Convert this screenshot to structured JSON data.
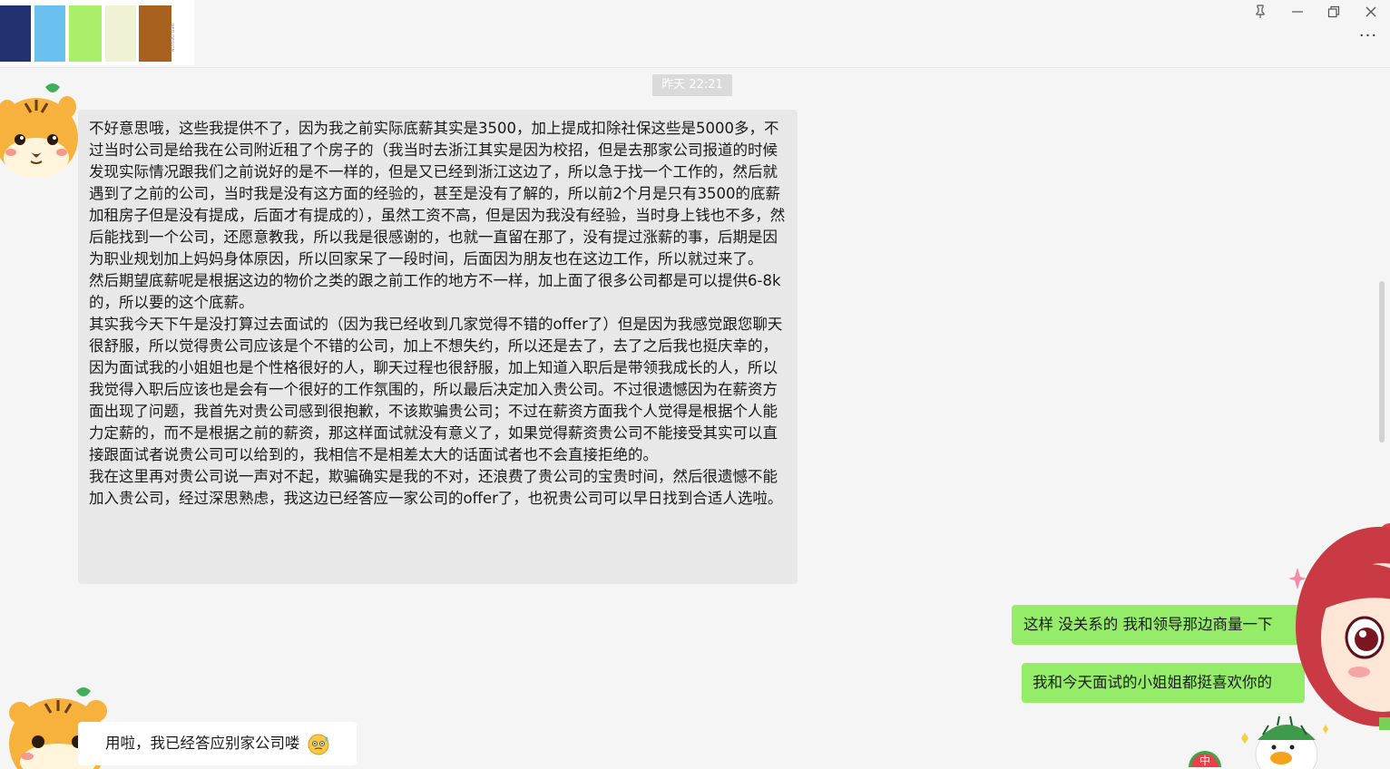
{
  "palette": {
    "swatches": [
      "#223170",
      "#6ac0ef",
      "#aaef6a",
      "#f1f1d6",
      "#a8601f"
    ],
    "caption": "RED DESIGN"
  },
  "window_controls": {
    "pin": "⊼",
    "minimize": "—",
    "restore": "❐",
    "close": "✕",
    "more": "···"
  },
  "chat": {
    "timestamp": "昨天 22:21",
    "messages": [
      {
        "side": "left",
        "text": "不好意思哦，这些我提供不了，因为我之前实际底薪其实是3500，加上提成扣除社保这些是5000多，不过当时公司是给我在公司附近租了个房子的（我当时去浙江其实是因为校招，但是去那家公司报道的时候发现实际情况跟我们之前说好的是不一样的，但是又已经到浙江这边了，所以急于找一个工作的，然后就遇到了之前的公司，当时我是没有这方面的经验的，甚至是没有了解的，所以前2个月是只有3500的底薪加租房子但是没有提成，后面才有提成的），虽然工资不高，但是因为我没有经验，当时身上钱也不多，然后能找到一个公司，还愿意教我，所以我是很感谢的，也就一直留在那了，没有提过涨薪的事，后期是因为职业规划加上妈妈身体原因，所以回家呆了一段时间，后面因为朋友也在这边工作，所以就过来了。\n然后期望底薪呢是根据这边的物价之类的跟之前工作的地方不一样，加上面了很多公司都是可以提供6-8k的，所以要的这个底薪。\n其实我今天下午是没打算过去面试的（因为我已经收到几家觉得不错的offer了）但是因为我感觉跟您聊天很舒服，所以觉得贵公司应该是个不错的公司，加上不想失约，所以还是去了，去了之后我也挺庆幸的，因为面试我的小姐姐也是个性格很好的人，聊天过程也很舒服，加上知道入职后是带领我成长的人，所以我觉得入职后应该也是会有一个很好的工作氛围的，所以最后决定加入贵公司。不过很遗憾因为在薪资方面出现了问题，我首先对贵公司感到很抱歉，不该欺骗贵公司；不过在薪资方面我个人觉得是根据个人能力定薪的，而不是根据之前的薪资，那这样面试就没有意义了，如果觉得薪资贵公司不能接受其实可以直接跟面试者说贵公司可以给到的，我相信不是相差太大的话面试者也不会直接拒绝的。\n我在这里再对贵公司说一声对不起，欺骗确实是我的不对，还浪费了贵公司的宝贵时间，然后很遗憾不能加入贵公司，经过深思熟虑，我这边已经答应一家公司的offer了，也祝贵公司可以早日找到合适人选啦。"
      },
      {
        "side": "right",
        "text": "这样 没关系的 我和领导那边商量一下"
      },
      {
        "side": "right",
        "text": "我和今天面试的小姐姐都挺喜欢你的"
      },
      {
        "side": "left",
        "text": "用啦，我已经答应别家公司喽"
      }
    ]
  },
  "stickers": {
    "watermelon_label": "中"
  }
}
